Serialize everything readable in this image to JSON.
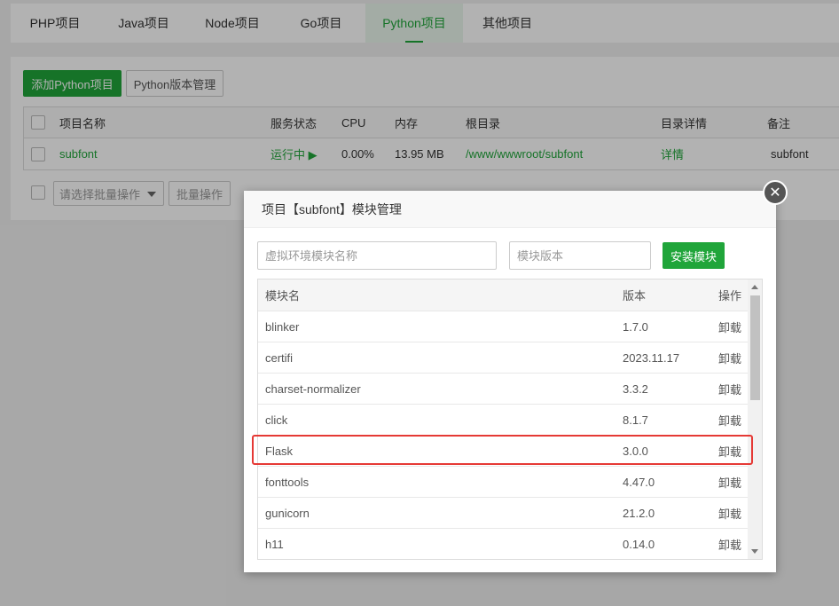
{
  "tabs": [
    {
      "label": "PHP项目"
    },
    {
      "label": "Java项目"
    },
    {
      "label": "Node项目"
    },
    {
      "label": "Go项目"
    },
    {
      "label": "Python项目"
    },
    {
      "label": "其他项目"
    }
  ],
  "toolbar": {
    "add_label": "添加Python项目",
    "version_label": "Python版本管理"
  },
  "project_table": {
    "headers": {
      "name": "项目名称",
      "status": "服务状态",
      "cpu": "CPU",
      "memory": "内存",
      "root": "根目录",
      "detail": "目录详情",
      "note": "备注"
    },
    "rows": [
      {
        "name": "subfont",
        "status": "运行中 ▶",
        "cpu": "0.00%",
        "memory": "13.95 MB",
        "root": "/www/wwwroot/subfont",
        "detail": "详情",
        "note": "subfont"
      }
    ]
  },
  "batch": {
    "select_placeholder": "请选择批量操作",
    "button_label": "批量操作"
  },
  "dialog": {
    "title": "项目【subfont】模块管理",
    "name_placeholder": "虚拟环境模块名称",
    "version_placeholder": "模块版本",
    "install_label": "安装模块",
    "headers": {
      "name": "模块名",
      "version": "版本",
      "action": "操作"
    },
    "modules": [
      {
        "name": "blinker",
        "version": "1.7.0",
        "action": "卸载"
      },
      {
        "name": "certifi",
        "version": "2023.11.17",
        "action": "卸载"
      },
      {
        "name": "charset-normalizer",
        "version": "3.3.2",
        "action": "卸载"
      },
      {
        "name": "click",
        "version": "8.1.7",
        "action": "卸载"
      },
      {
        "name": "Flask",
        "version": "3.0.0",
        "action": "卸载"
      },
      {
        "name": "fonttools",
        "version": "4.47.0",
        "action": "卸载"
      },
      {
        "name": "gunicorn",
        "version": "21.2.0",
        "action": "卸载"
      },
      {
        "name": "h11",
        "version": "0.14.0",
        "action": "卸载"
      }
    ],
    "close_symbol": "✕"
  },
  "colors": {
    "accent": "#20a53a",
    "highlight": "#e53935"
  },
  "icons": {
    "close": "close-icon",
    "play": "play-icon",
    "dropdown": "chevron-down-icon"
  }
}
